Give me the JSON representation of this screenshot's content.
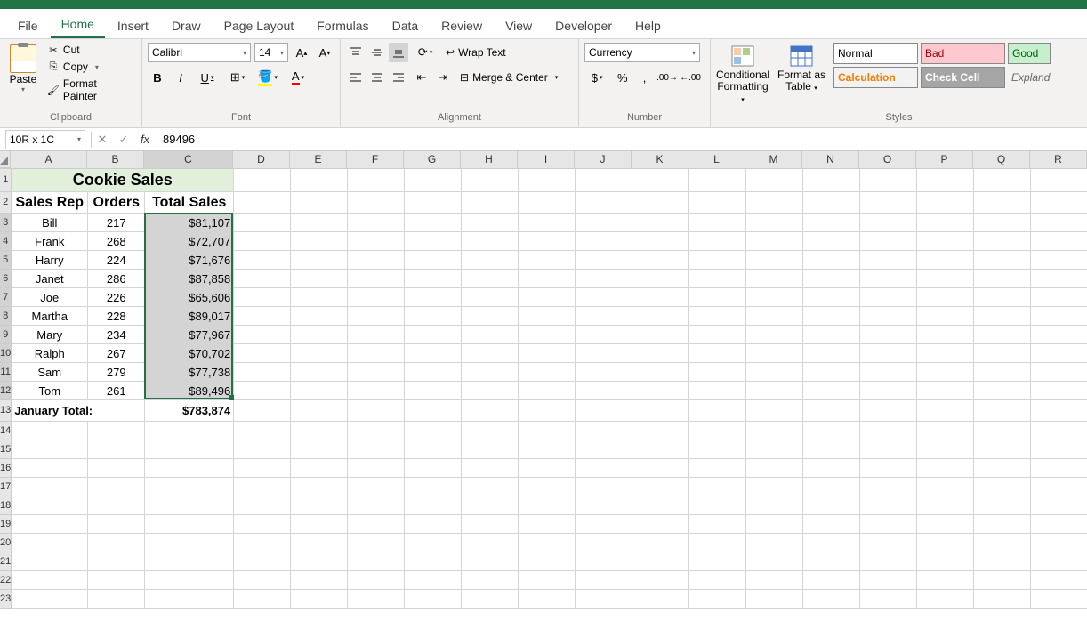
{
  "tabs": {
    "file": "File",
    "home": "Home",
    "insert": "Insert",
    "draw": "Draw",
    "pagelayout": "Page Layout",
    "formulas": "Formulas",
    "data": "Data",
    "review": "Review",
    "view": "View",
    "developer": "Developer",
    "help": "Help"
  },
  "ribbon": {
    "clipboard": {
      "label": "Clipboard",
      "paste": "Paste",
      "cut": "Cut",
      "copy": "Copy",
      "fp": "Format Painter"
    },
    "font": {
      "label": "Font",
      "name": "Calibri",
      "size": "14"
    },
    "alignment": {
      "label": "Alignment",
      "wrap": "Wrap Text",
      "merge": "Merge & Center"
    },
    "number": {
      "label": "Number",
      "format": "Currency"
    },
    "styles": {
      "label": "Styles",
      "cf": "Conditional Formatting",
      "fat": "Format as Table",
      "normal": "Normal",
      "bad": "Bad",
      "good": "Good",
      "calc": "Calculation",
      "check": "Check Cell",
      "explan": "Expland"
    }
  },
  "namebox": "10R x 1C",
  "formula": "89496",
  "cols": [
    "A",
    "B",
    "C",
    "D",
    "E",
    "F",
    "G",
    "H",
    "I",
    "J",
    "K",
    "L",
    "M",
    "N",
    "O",
    "P",
    "Q",
    "R"
  ],
  "sheet": {
    "title": "Cookie Sales",
    "headers": {
      "a": "Sales Rep",
      "b": "Orders",
      "c": "Total Sales"
    },
    "rows": [
      {
        "a": "Bill",
        "b": "217",
        "c": "$81,107"
      },
      {
        "a": "Frank",
        "b": "268",
        "c": "$72,707"
      },
      {
        "a": "Harry",
        "b": "224",
        "c": "$71,676"
      },
      {
        "a": "Janet",
        "b": "286",
        "c": "$87,858"
      },
      {
        "a": "Joe",
        "b": "226",
        "c": "$65,606"
      },
      {
        "a": "Martha",
        "b": "228",
        "c": "$89,017"
      },
      {
        "a": "Mary",
        "b": "234",
        "c": "$77,967"
      },
      {
        "a": "Ralph",
        "b": "267",
        "c": "$70,702"
      },
      {
        "a": "Sam",
        "b": "279",
        "c": "$77,738"
      },
      {
        "a": "Tom",
        "b": "261",
        "c": "$89,496"
      }
    ],
    "total": {
      "label": "January Total:",
      "value": "$783,874"
    }
  }
}
